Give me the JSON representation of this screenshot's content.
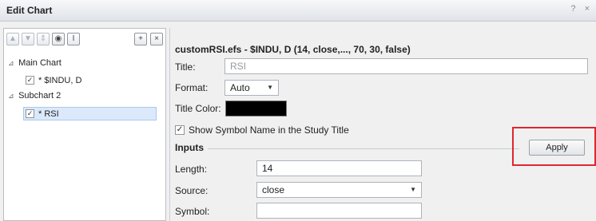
{
  "window": {
    "title": "Edit Chart",
    "controls": [
      "?",
      "×"
    ]
  },
  "toolbar": {
    "buttons": [
      {
        "icon": "move-up-icon",
        "glyph": "▲"
      },
      {
        "icon": "move-down-icon",
        "glyph": "▼"
      },
      {
        "icon": "reorder-icon",
        "glyph": "⇕"
      },
      {
        "icon": "eye-icon",
        "glyph": "◉"
      },
      {
        "icon": "text-icon",
        "glyph": "I"
      },
      {
        "icon": "add-icon",
        "glyph": "+"
      },
      {
        "icon": "remove-icon",
        "glyph": "×"
      }
    ]
  },
  "tree": {
    "main_chart": {
      "label": "Main Chart",
      "expander": "⊿"
    },
    "main_item": {
      "label": "* $INDU, D",
      "checked": "✓"
    },
    "subchart": {
      "label": "Subchart 2",
      "expander": "⊿"
    },
    "sub_item": {
      "label": "* RSI",
      "checked": "✓"
    }
  },
  "study": {
    "header": "customRSI.efs - $INDU, D (14, close,..., 70, 30, false)",
    "title_label": "Title:",
    "title_placeholder": "RSI",
    "format_label": "Format:",
    "format_value": "Auto",
    "title_color_label": "Title Color:",
    "title_color": "#000000",
    "show_symbol_label": "Show Symbol Name in the Study Title",
    "show_symbol_checked": "✓"
  },
  "inputs": {
    "section_title": "Inputs",
    "apply_label": "Apply",
    "length_label": "Length:",
    "length_value": "14",
    "source_label": "Source:",
    "source_value": "close",
    "symbol_label": "Symbol:",
    "symbol_value": ""
  },
  "colors": {
    "highlight": "#e0262e",
    "selection": "#dbe9fb"
  }
}
